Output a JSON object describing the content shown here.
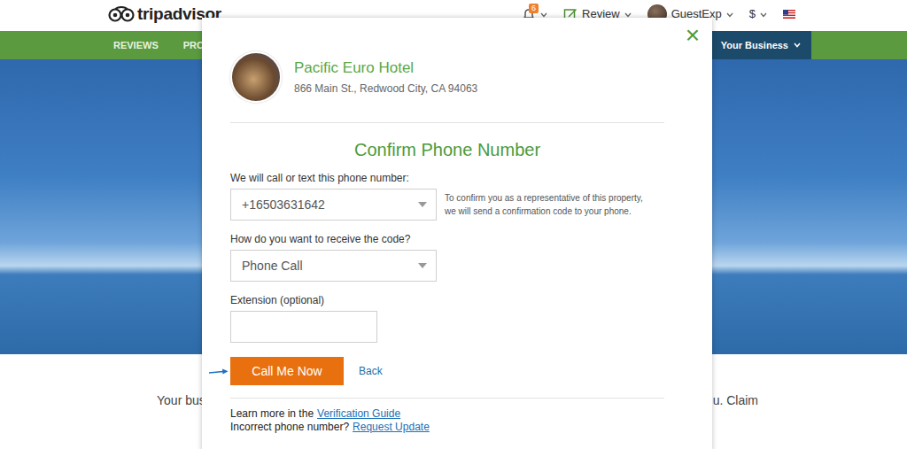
{
  "header": {
    "logo": "tripadvisor",
    "notifications": {
      "count": "6"
    },
    "review_label": "Review",
    "user_name": "GuestExp",
    "currency": "$"
  },
  "nav": {
    "items": [
      {
        "label": "REVIEWS",
        "selected": false
      },
      {
        "label": "PRODU",
        "selected": false
      }
    ],
    "business_menu": {
      "label": "Your Business"
    }
  },
  "page": {
    "text_left": "Your bus",
    "text_right": "u. Claim"
  },
  "modal": {
    "close": "×",
    "property": {
      "name": "Pacific Euro Hotel",
      "address": "866 Main St., Redwood City, CA 94063"
    },
    "title": "Confirm Phone Number",
    "fields": [
      {
        "kind": "select",
        "label": "We will call or text this phone number:",
        "value": "+16503631642",
        "note": "To confirm you as a representative of this property, we will send a confirmation code to your phone."
      },
      {
        "kind": "select",
        "label": "How do you want to receive the code?",
        "value": "Phone Call",
        "note": ""
      },
      {
        "kind": "input",
        "label": "Extension (optional)",
        "value": "",
        "note": ""
      }
    ],
    "primary_button": "Call Me Now",
    "secondary_link": "Back",
    "footer": [
      {
        "text": "Learn more in the",
        "link": "Verification Guide"
      },
      {
        "text": "Incorrect phone number?",
        "link": "Request Update"
      }
    ]
  }
}
